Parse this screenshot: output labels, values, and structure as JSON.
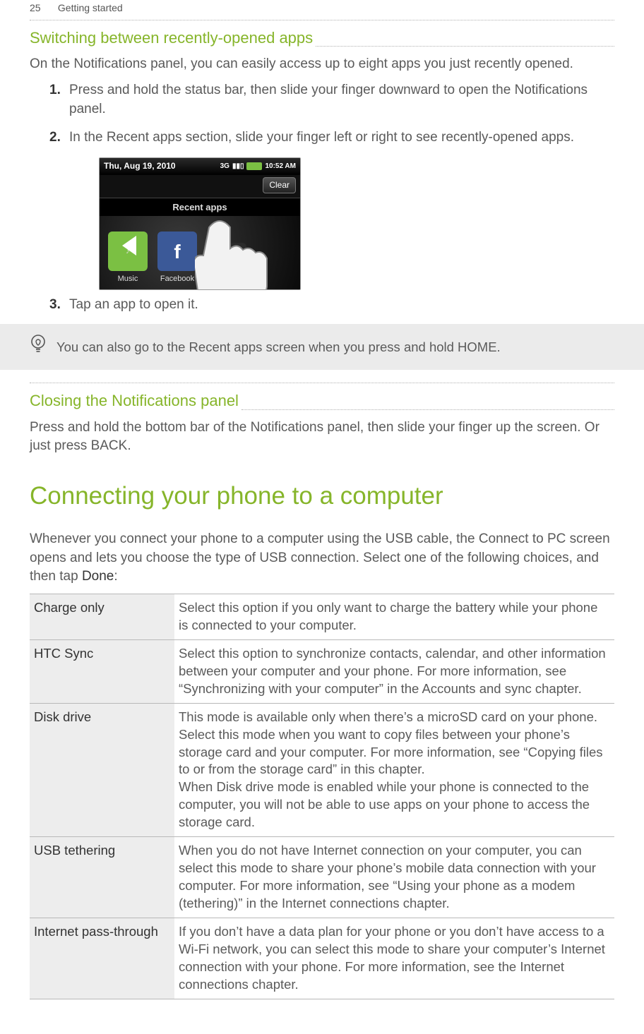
{
  "header": {
    "page_number": "25",
    "chapter": "Getting started"
  },
  "section1": {
    "heading": "Switching between recently-opened apps",
    "intro": "On the Notifications panel, you can easily access up to eight apps you just recently opened.",
    "steps": [
      "Press and hold the status bar, then slide your finger downward to open the Notifications panel.",
      "In the Recent apps section, slide your finger left or right to see recently-opened apps.",
      "Tap an app to open it."
    ]
  },
  "screenshot": {
    "date": "Thu, Aug 19, 2010",
    "network": "3G",
    "time": "10:52 AM",
    "clear_label": "Clear",
    "recent_label": "Recent apps",
    "apps": [
      {
        "label": "Music"
      },
      {
        "label": "Facebook"
      },
      {
        "label": ""
      }
    ]
  },
  "tip": {
    "text": "You can also go to the Recent apps screen when you press and hold HOME."
  },
  "section2": {
    "heading": "Closing the Notifications panel",
    "body": "Press and hold the bottom bar of the Notifications panel, then slide your finger up the screen. Or just press BACK."
  },
  "section3": {
    "heading": "Connecting your phone to a computer",
    "intro_pre": "Whenever you connect your phone to a computer using the USB cable, the Connect to PC screen opens and lets you choose the type of USB connection. Select one of the following choices, and then tap ",
    "intro_bold": "Done",
    "intro_post": ":",
    "rows": [
      {
        "label": "Charge only",
        "desc": "Select this option if you only want to charge the battery while your phone is connected to your computer."
      },
      {
        "label": "HTC Sync",
        "desc": "Select this option to synchronize contacts, calendar, and other information between your computer and your phone. For more information, see “Synchronizing with your computer” in the Accounts and sync chapter."
      },
      {
        "label": "Disk drive",
        "desc": "This mode is available only when there’s a microSD card on your phone. Select this mode when you want to copy files between your phone’s storage card and your computer. For more information, see “Copying files to or from the storage card” in this chapter.\nWhen Disk drive mode is enabled while your phone is connected to the computer, you will not be able to use apps on your phone to access the storage card."
      },
      {
        "label": "USB tethering",
        "desc": "When you do not have Internet connection on your computer, you can select this mode to share your phone’s mobile data connection with your computer. For more information, see “Using your phone as a modem (tethering)” in the Internet connections chapter."
      },
      {
        "label": "Internet pass-through",
        "desc": "If you don’t have a data plan for your phone or you don’t have access to a Wi-Fi network, you can select this mode to share your computer’s Internet connection with your phone. For more information, see the Internet connections chapter."
      }
    ]
  }
}
